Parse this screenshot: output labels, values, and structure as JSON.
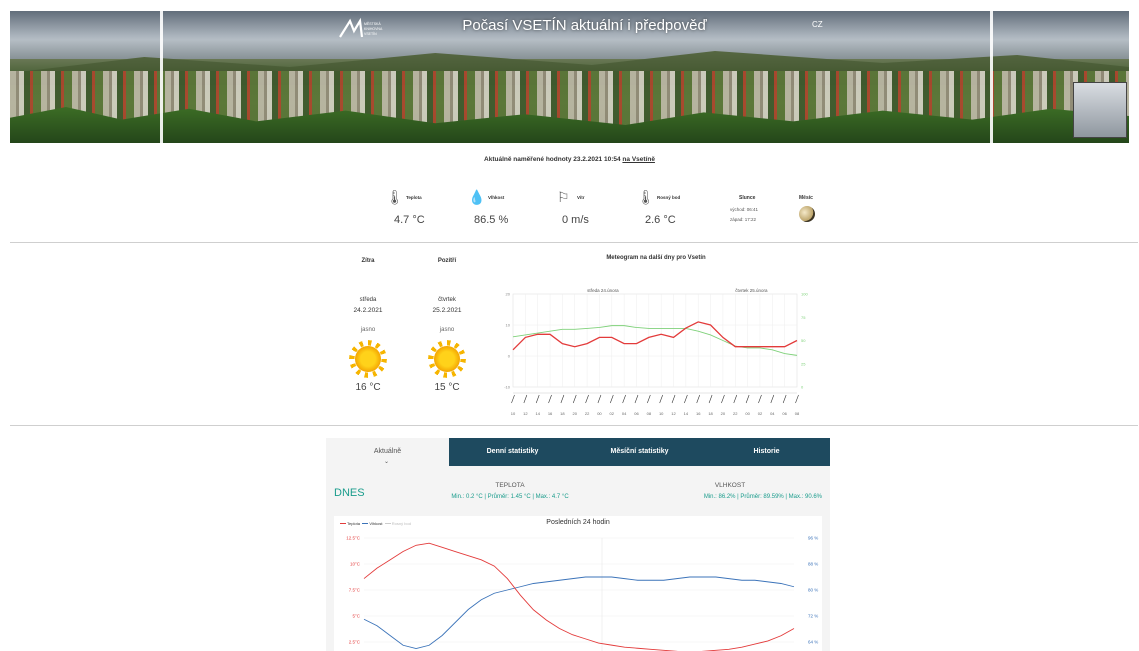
{
  "header": {
    "title": "Počasí VSETÍN aktuální i předpověď",
    "lang": "CZ",
    "logo_text": "MĚSTSKÁ KNIHOVNA VSETÍN"
  },
  "current": {
    "heading_prefix": "Aktuálně naměřené hodnoty 23.2.2021 10:54",
    "heading_link": "na Vsetíně",
    "temperature": {
      "label": "Teplota",
      "value": "4.7 °C"
    },
    "humidity": {
      "label": "Vlhkost",
      "value": "86.5 %"
    },
    "wind": {
      "label": "Vítr",
      "value": "0 m/s"
    },
    "dew_point": {
      "label": "Rosný bod",
      "value": "2.6 °C"
    },
    "sun": {
      "label": "Slunce",
      "rise": "východ: 06:41",
      "set": "západ: 17:22"
    },
    "moon": {
      "label": "Měsíc"
    }
  },
  "forecast": {
    "col1_title": "Zítra",
    "col2_title": "Pozítří",
    "days": [
      {
        "day": "středa",
        "date": "24.2.2021",
        "cond": "jasno",
        "temp": "16 °C"
      },
      {
        "day": "čtvrtek",
        "date": "25.2.2021",
        "cond": "jasno",
        "temp": "15 °C"
      }
    ],
    "meteogram_title": "Meteogram na další dny pro Vsetín",
    "meteogram_day1": "středa 24.února",
    "meteogram_day2": "čtvrtek 25.února"
  },
  "tabs": [
    "Aktuálně",
    "Denní statistiky",
    "Měsíční statistiky",
    "Historie"
  ],
  "stats": {
    "today": "DNES",
    "temp_title": "TEPLOTA",
    "temp_line": "Min.: 0.2 °C | Průměr: 1.45 °C | Max.: 4.7 °C",
    "hum_title": "VLHKOST",
    "hum_line": "Min.: 86.2% | Průměr: 89.59% | Max.: 90.6%",
    "chart_title": "Posledních 24 hodin"
  },
  "chart_data": [
    {
      "type": "line",
      "title": "Meteogram na další dny pro Vsetín",
      "x": [
        "10",
        "12",
        "14",
        "16",
        "18",
        "20",
        "22",
        "00",
        "02",
        "04",
        "06",
        "08",
        "10",
        "12",
        "14",
        "16",
        "18",
        "20",
        "22",
        "00",
        "02",
        "04",
        "06",
        "08"
      ],
      "series": [
        {
          "name": "Teplota",
          "color": "#e33b3b",
          "values": [
            2,
            6,
            7,
            7,
            4,
            3,
            4,
            6,
            6,
            4,
            4,
            6,
            7,
            6,
            9,
            11,
            10,
            6,
            3,
            3,
            3,
            3,
            3,
            5
          ]
        },
        {
          "name": "Vlhkost",
          "color": "#7fd17a",
          "values": [
            54,
            56,
            58,
            60,
            62,
            62,
            63,
            64,
            66,
            66,
            64,
            63,
            63,
            63,
            63,
            60,
            56,
            50,
            44,
            42,
            42,
            40,
            36,
            34
          ]
        }
      ],
      "ylim_left": [
        -10,
        20
      ],
      "ylim_right": [
        0,
        100
      ],
      "yticks_left": [
        "20",
        "10",
        "0",
        "-10"
      ],
      "yticks_right": [
        "100",
        "75",
        "50",
        "25",
        "0"
      ],
      "grid": true
    },
    {
      "type": "line",
      "title": "Posledních 24 hodin",
      "legend": [
        "Teplota",
        "Vlhkost",
        "Rosný bod"
      ],
      "legend_placement": "top-left",
      "y_left_ticks": [
        "12.5°C",
        "10°C",
        "7.5°C",
        "5°C",
        "2.5°C"
      ],
      "y_right_ticks": [
        "96 %",
        "88 %",
        "80 %",
        "72 %",
        "64 %"
      ],
      "series": [
        {
          "name": "Teplota",
          "color": "#e33b3b",
          "values": [
            8.6,
            9.6,
            10.4,
            11.2,
            11.8,
            12.0,
            11.6,
            11.2,
            10.8,
            10.4,
            9.8,
            8.6,
            7.0,
            5.6,
            4.6,
            3.8,
            3.2,
            2.8,
            2.4,
            2.2,
            2.0,
            1.9,
            1.8,
            1.7,
            1.6,
            1.5,
            1.6,
            1.7,
            1.8,
            2.0,
            2.3,
            2.6,
            3.1,
            3.8
          ]
        },
        {
          "name": "Vlhkost",
          "color": "#3b73b9",
          "values": [
            71,
            69,
            66,
            63,
            62,
            63,
            66,
            70,
            74,
            77,
            79,
            80,
            81,
            82,
            82.5,
            83,
            83.5,
            84,
            84,
            84,
            83.5,
            83,
            83,
            83,
            83.5,
            84,
            84,
            84,
            83.5,
            83,
            83,
            82.5,
            82,
            81
          ]
        },
        {
          "name": "Rosný bod",
          "color": "#cccccc",
          "values": []
        }
      ],
      "grid": true
    }
  ]
}
